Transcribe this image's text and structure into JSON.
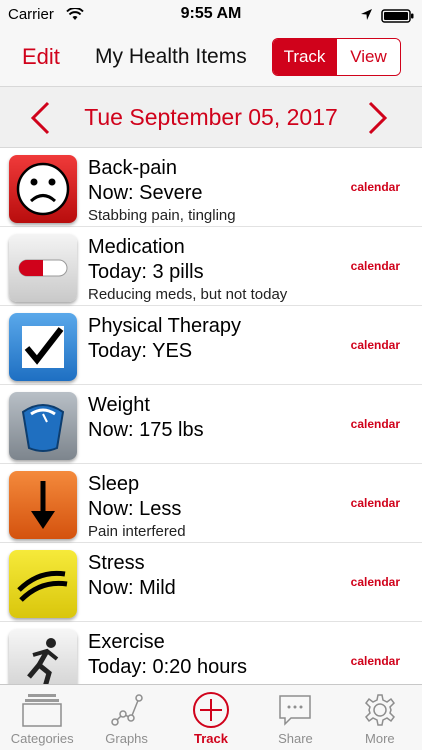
{
  "status_bar": {
    "carrier": "Carrier",
    "time": "9:55 AM",
    "icons": [
      "wifi-icon",
      "location-icon",
      "battery-icon"
    ]
  },
  "nav": {
    "edit_label": "Edit",
    "title": "My Health Items",
    "segments": [
      "Track",
      "View"
    ],
    "selected_segment": "Track"
  },
  "date_bar": {
    "date": "Tue September 05, 2017"
  },
  "items": [
    {
      "title": "Back-pain",
      "value": "Now: Severe",
      "note": "Stabbing pain, tingling",
      "link": "calendar",
      "icon": "sad-face-icon"
    },
    {
      "title": "Medication",
      "value": "Today: 3 pills",
      "note": "Reducing meds, but not today",
      "link": "calendar",
      "icon": "pill-icon"
    },
    {
      "title": "Physical Therapy",
      "value": "Today: YES",
      "note": "",
      "link": "calendar",
      "icon": "checkmark-icon"
    },
    {
      "title": "Weight",
      "value": "Now: 175 lbs",
      "note": "",
      "link": "calendar",
      "icon": "scale-icon"
    },
    {
      "title": "Sleep",
      "value": "Now: Less",
      "note": "Pain interfered",
      "link": "calendar",
      "icon": "down-arrow-icon"
    },
    {
      "title": "Stress",
      "value": "Now: Mild",
      "note": "",
      "link": "calendar",
      "icon": "stress-lines-icon"
    },
    {
      "title": "Exercise",
      "value": "Today: 0:20 hours",
      "note": "",
      "link": "calendar",
      "icon": "runner-icon"
    }
  ],
  "tabs": [
    {
      "label": "Categories",
      "icon": "categories-icon"
    },
    {
      "label": "Graphs",
      "icon": "graphs-icon"
    },
    {
      "label": "Track",
      "icon": "track-plus-icon"
    },
    {
      "label": "Share",
      "icon": "share-icon"
    },
    {
      "label": "More",
      "icon": "more-gear-icon"
    }
  ],
  "active_tab": "Track",
  "colors": {
    "accent": "#d0021b",
    "tab_inactive": "#8e8e8e"
  }
}
